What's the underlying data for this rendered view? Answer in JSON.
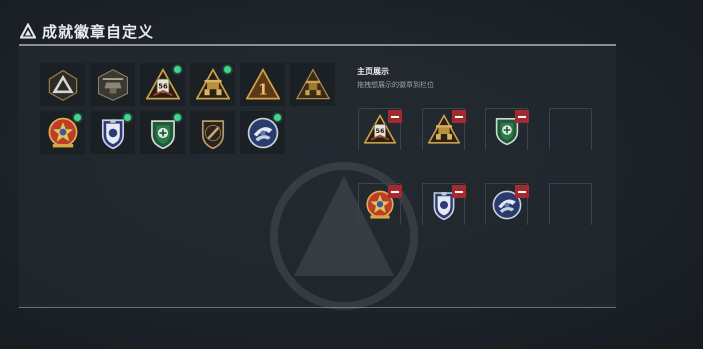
{
  "header": {
    "title": "成就徽章自定义",
    "icon": "triangle-emblem-icon"
  },
  "inventory": {
    "rows": [
      [
        {
          "icon": "dark-triangle-badge-icon",
          "new": false
        },
        {
          "icon": "helicopter-badge-icon",
          "new": false
        },
        {
          "icon": "triangle-56-badge-icon",
          "new": true
        },
        {
          "icon": "gold-tower-triangle-badge-icon",
          "new": true
        },
        {
          "icon": "number-1-triangle-badge-icon",
          "new": false
        },
        {
          "icon": "tower-triangle-badge-icon",
          "new": false
        }
      ],
      [
        {
          "icon": "gold-star-badge-icon",
          "new": true
        },
        {
          "icon": "blue-shield-badge-icon",
          "new": true
        },
        {
          "icon": "green-shield-badge-icon",
          "new": true
        },
        {
          "icon": "bronze-shield-badge-icon",
          "new": false
        },
        {
          "icon": "blue-wing-badge-icon",
          "new": true
        }
      ]
    ]
  },
  "display": {
    "title": "主页展示",
    "subtitle": "拖拽想展示的徽章到栏位",
    "slots": [
      {
        "icon": "triangle-56-badge-icon",
        "filled": true
      },
      {
        "icon": "gold-tower-triangle-badge-icon",
        "filled": true
      },
      {
        "icon": "green-shield-badge-icon",
        "filled": true
      },
      {
        "icon": "empty-slot",
        "filled": false
      },
      {
        "icon": "gold-star-badge-icon",
        "filled": true
      },
      {
        "icon": "blue-shield-badge-icon",
        "filled": true
      },
      {
        "icon": "blue-wing-badge-icon",
        "filled": true
      },
      {
        "icon": "empty-slot",
        "filled": false
      }
    ]
  },
  "colors": {
    "accent": "#42d58a",
    "remove": "#a32a2e",
    "gold": "#c9a24a",
    "panel": "#22282e"
  }
}
